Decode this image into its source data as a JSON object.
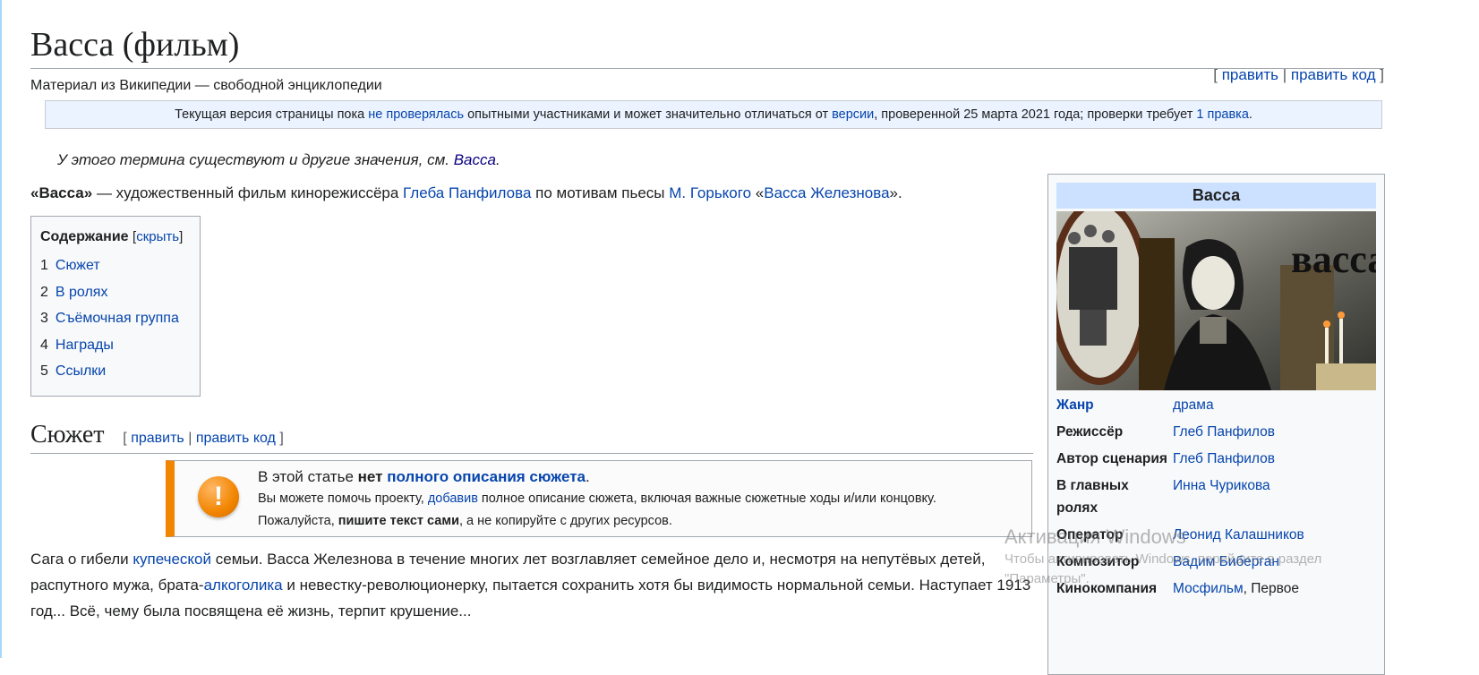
{
  "article": {
    "title": "Васса (фильм)",
    "tagline": "Материал из Википедии — свободной энциклопедии",
    "edit_links": {
      "open": "[",
      "edit": "править",
      "sep": "|",
      "edit_source": "править код",
      "close": "]"
    }
  },
  "flagged": {
    "t1": "Текущая версия страницы пока ",
    "link1": "не проверялась",
    "t2": " опытными участниками и может значительно отличаться от ",
    "link2": "версии",
    "t3": ", проверенной 25 марта 2021 года; проверки требует ",
    "link3": "1 правка",
    "t4": "."
  },
  "hatnote": {
    "text": "У этого термина существуют и другие значения, см. ",
    "link": "Васса",
    "end": "."
  },
  "lead": {
    "bold": "«Васса»",
    "t1": " — художественный фильм кинорежиссёра ",
    "link1": "Глеба Панфилова",
    "t2": " по мотивам пьесы ",
    "link2": "М. Горького",
    "t3": " «",
    "link3": "Васса Железнова",
    "t4": "»."
  },
  "toc": {
    "heading": "Содержание",
    "toggle_open": "[",
    "toggle": "скрыть",
    "toggle_close": "]",
    "items": [
      {
        "num": "1",
        "label": "Сюжет"
      },
      {
        "num": "2",
        "label": "В ролях"
      },
      {
        "num": "3",
        "label": "Съёмочная группа"
      },
      {
        "num": "4",
        "label": "Награды"
      },
      {
        "num": "5",
        "label": "Ссылки"
      }
    ]
  },
  "section": {
    "title": "Сюжет",
    "edit_open": "[",
    "edit": "править",
    "sep": "|",
    "edit_source": "править код",
    "edit_close": "]"
  },
  "ambox": {
    "icon": "exclamation-icon",
    "l1_a": "В этой статье ",
    "l1_b": "нет",
    "l1_c": " ",
    "l1_link": "полного описания сюжета",
    "l1_d": ".",
    "l2_a": "Вы можете помочь проекту, ",
    "l2_link": "добавив",
    "l2_b": " полное описание сюжета, включая важные сюжетные ходы и/или концовку.",
    "l3_a": "Пожалуйста, ",
    "l3_b": "пишите текст сами",
    "l3_c": ", а не копируйте с других ресурсов.",
    "accent": "#f28500"
  },
  "plot": {
    "t1": "Сага о гибели ",
    "link1": "купеческой",
    "t2": " семьи. Васса Железнова в течение многих лет возглавляет семейное дело и, несмотря на непутёвых детей, распутного мужа, брата-",
    "link2": "алкоголика",
    "t3": " и невестку-революционерку, пытается сохранить хотя бы видимость нормальной семьи. Наступает 1913 год... Всё, чему была посвящена её жизнь, терпит крушение..."
  },
  "infobox": {
    "title": "Васса",
    "poster_text": "васса",
    "rows": [
      {
        "label": "Жанр",
        "value": "драма"
      },
      {
        "label": "Режиссёр",
        "value": "Глеб Панфилов"
      },
      {
        "label": "Автор сценария",
        "value": "Глеб Панфилов"
      },
      {
        "label": "В главных ролях",
        "value": "Инна Чурикова"
      },
      {
        "label": "Оператор",
        "value": "Леонид Калашников"
      },
      {
        "label": "Композитор",
        "value": "Вадим Биберган"
      },
      {
        "label": "Кинокомпания",
        "value": "Мосфильм",
        "value_tail": ", Первое"
      }
    ]
  },
  "watermark": {
    "line1": "Активация Windows",
    "line2": "Чтобы активировать Windows, перейдите в раздел",
    "line3": "\"Параметры\"."
  }
}
